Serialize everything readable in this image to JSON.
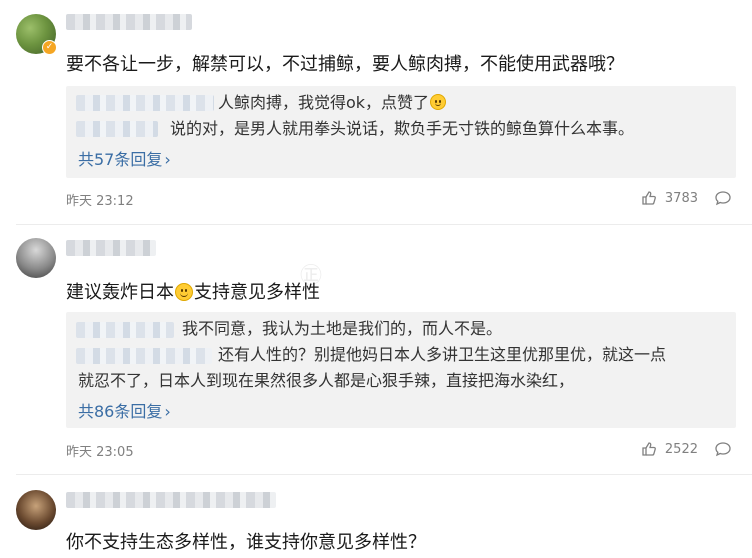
{
  "comments": [
    {
      "text": "要不各让一步，解禁可以，不过捕鲸，要人鲸肉搏，不能使用武器哦？",
      "replies": [
        {
          "text": "人鲸肉搏，我觉得ok，点赞了",
          "emoji": "doge-emoji"
        },
        {
          "text": "说的对，是男人就用拳头说话，欺负手无寸铁的鲸鱼算什么本事。"
        }
      ],
      "more_replies": "共57条回复",
      "time": "昨天 23:12",
      "likes": "3783"
    },
    {
      "text_before_emoji": "建议轰炸日本",
      "text_after_emoji": "支持意见多样性",
      "replies": [
        {
          "text": "我不同意，我认为土地是我们的，而人不是。"
        },
        {
          "text": "还有人性的？别提他妈日本人多讲卫生这里优那里优，就这一点",
          "continuation": "就忍不了，日本人到现在果然很多人都是心狠手辣，直接把海水染红，"
        }
      ],
      "more_replies": "共86条回复",
      "time": "昨天 23:05",
      "likes": "2522"
    },
    {
      "text": "你不支持生态多样性，谁支持你意见多样性？"
    }
  ],
  "icons": {
    "like": "thumbs-up-icon",
    "reply": "comment-bubble-icon",
    "verified": "verified-badge-icon"
  },
  "colors": {
    "link": "#3b6ea5",
    "meta": "#808080",
    "reply_bg": "#f2f2f2"
  }
}
